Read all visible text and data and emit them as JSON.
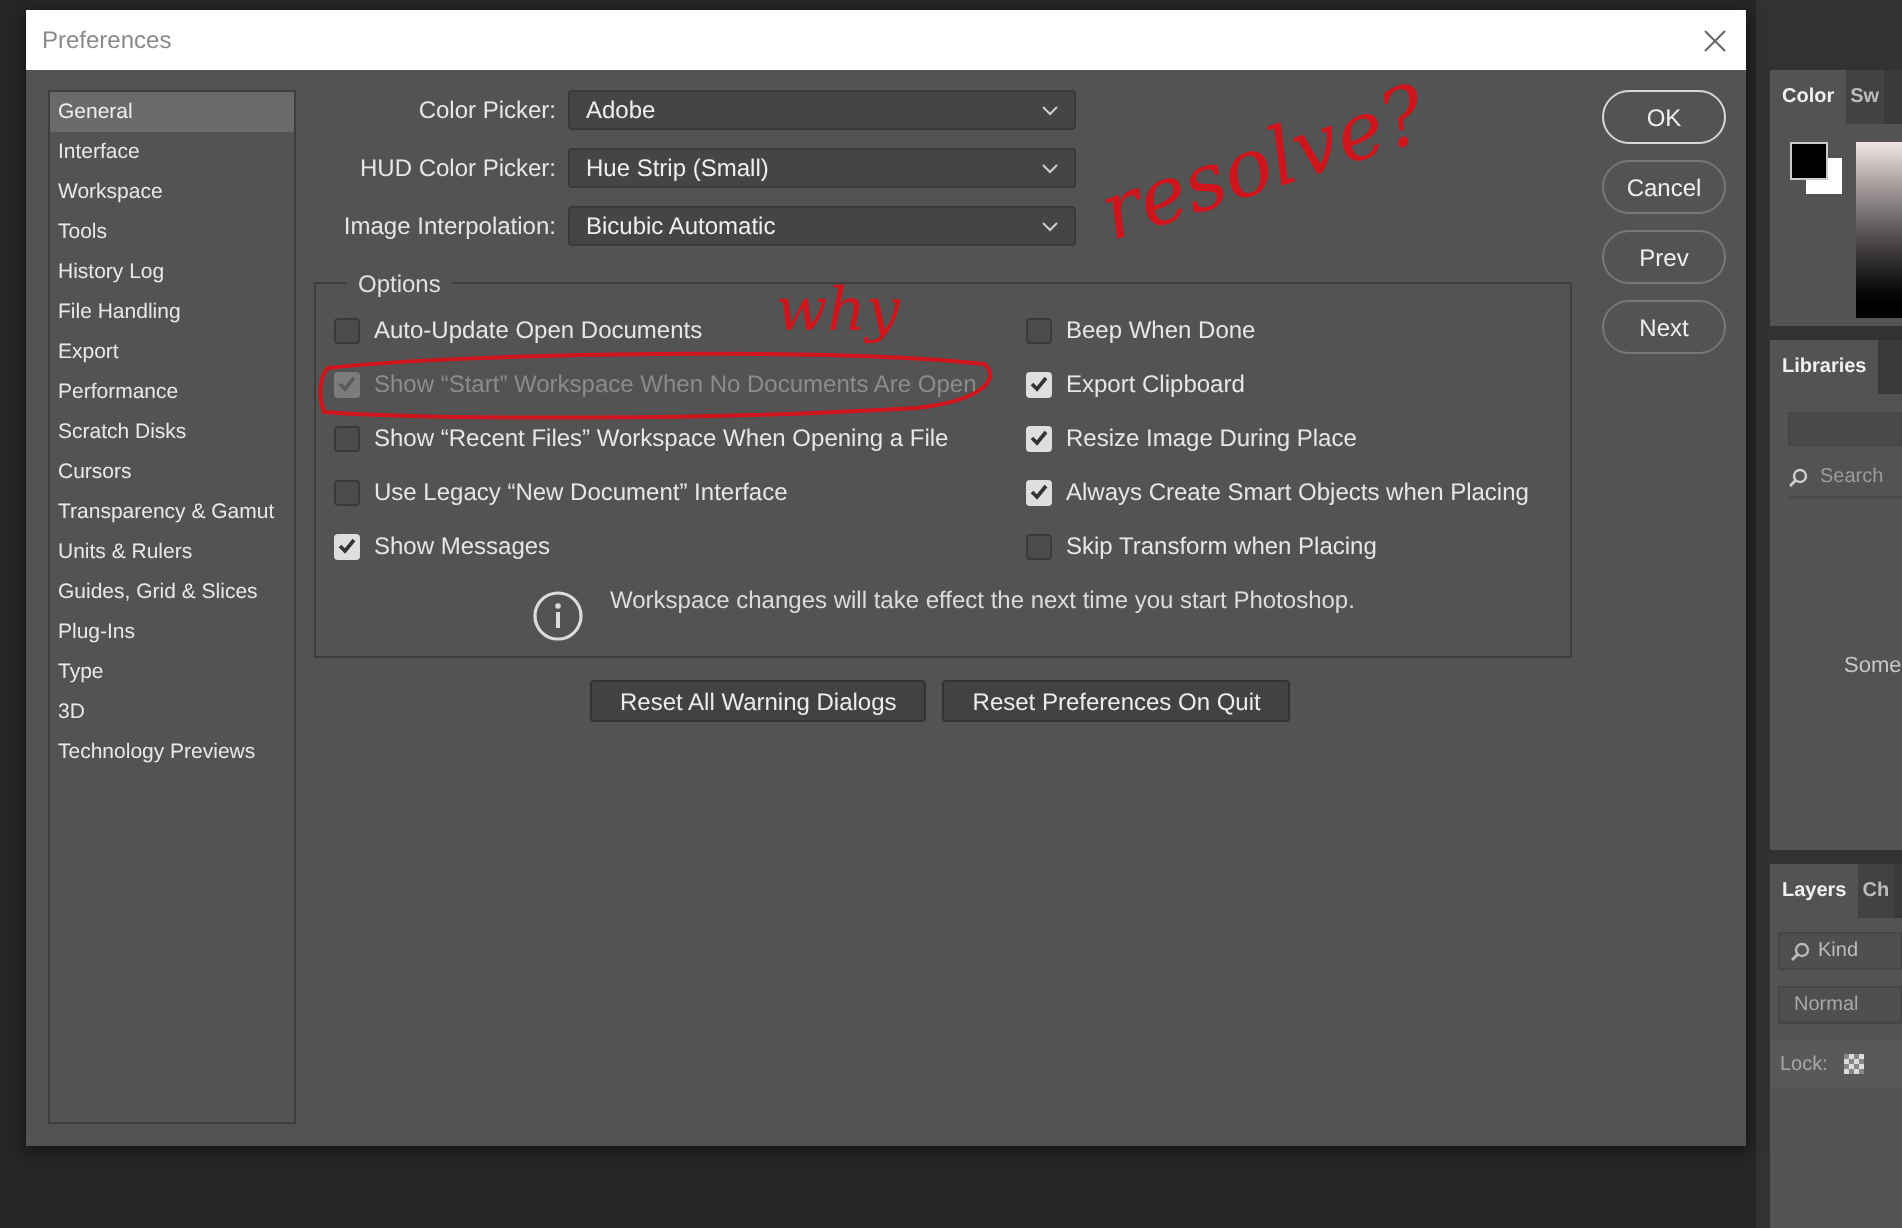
{
  "window": {
    "title": "Preferences"
  },
  "sidebar": {
    "items": [
      {
        "label": "General",
        "selected": true
      },
      {
        "label": "Interface",
        "selected": false
      },
      {
        "label": "Workspace",
        "selected": false
      },
      {
        "label": "Tools",
        "selected": false
      },
      {
        "label": "History Log",
        "selected": false
      },
      {
        "label": "File Handling",
        "selected": false
      },
      {
        "label": "Export",
        "selected": false
      },
      {
        "label": "Performance",
        "selected": false
      },
      {
        "label": "Scratch Disks",
        "selected": false
      },
      {
        "label": "Cursors",
        "selected": false
      },
      {
        "label": "Transparency & Gamut",
        "selected": false
      },
      {
        "label": "Units & Rulers",
        "selected": false
      },
      {
        "label": "Guides, Grid & Slices",
        "selected": false
      },
      {
        "label": "Plug-Ins",
        "selected": false
      },
      {
        "label": "Type",
        "selected": false
      },
      {
        "label": "3D",
        "selected": false
      },
      {
        "label": "Technology Previews",
        "selected": false
      }
    ]
  },
  "fields": [
    {
      "label": "Color Picker:",
      "value": "Adobe"
    },
    {
      "label": "HUD Color Picker:",
      "value": "Hue Strip (Small)"
    },
    {
      "label": "Image Interpolation:",
      "value": "Bicubic Automatic"
    }
  ],
  "options": {
    "title": "Options",
    "left": [
      {
        "label": "Auto-Update Open Documents",
        "checked": false,
        "disabled": false
      },
      {
        "label": "Show “Start” Workspace When No Documents Are Open",
        "checked": true,
        "disabled": true
      },
      {
        "label": "Show “Recent Files” Workspace When Opening a File",
        "checked": false,
        "disabled": false
      },
      {
        "label": "Use Legacy “New Document” Interface",
        "checked": false,
        "disabled": false
      },
      {
        "label": "Show Messages",
        "checked": true,
        "disabled": false
      }
    ],
    "right": [
      {
        "label": "Beep When Done",
        "checked": false,
        "disabled": false
      },
      {
        "label": "Export Clipboard",
        "checked": true,
        "disabled": false
      },
      {
        "label": "Resize Image During Place",
        "checked": true,
        "disabled": false
      },
      {
        "label": "Always Create Smart Objects when Placing",
        "checked": true,
        "disabled": false
      },
      {
        "label": "Skip Transform when Placing",
        "checked": false,
        "disabled": false
      }
    ],
    "note": "Workspace changes will take effect the next time you start Photoshop."
  },
  "reset_buttons": [
    "Reset All Warning Dialogs",
    "Reset Preferences On Quit"
  ],
  "buttons": [
    {
      "label": "OK",
      "default": true
    },
    {
      "label": "Cancel",
      "default": false
    },
    {
      "label": "Prev",
      "default": false
    },
    {
      "label": "Next",
      "default": false
    }
  ],
  "panels": {
    "color_tabs": [
      {
        "label": "Color",
        "selected": true
      },
      {
        "label": "Sw",
        "selected": false
      }
    ],
    "libraries_tabs": [
      {
        "label": "Libraries",
        "selected": true
      }
    ],
    "libraries_search": {
      "placeholder": "Search"
    },
    "libraries_message": "Some",
    "layers_tabs": [
      {
        "label": "Layers",
        "selected": true
      },
      {
        "label": "Ch",
        "selected": false
      }
    ],
    "layers_filter": "Kind",
    "blend_mode": "Normal",
    "lock_label": "Lock:"
  },
  "annotation": {
    "words": [
      "why",
      "resolve?"
    ]
  }
}
